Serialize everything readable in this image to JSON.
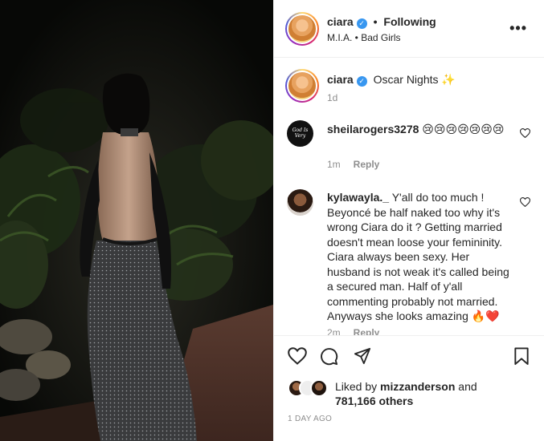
{
  "header": {
    "username": "ciara",
    "separator": "•",
    "follow_status": "Following",
    "audio": "M.I.A. • Bad Girls",
    "more_icon": "•••"
  },
  "caption": {
    "username": "ciara",
    "text": "Oscar Nights",
    "sparkle": "✨",
    "time": "1d"
  },
  "comments": [
    {
      "username": "sheilarogers3278",
      "text": "😢😢😢😢😢😢😢",
      "meta": "1m",
      "reply": "Reply",
      "avatar_text": "God Is Very"
    },
    {
      "username": "kylawayla._",
      "text": "Y'all do too much ! Beyoncé be half naked too why it's wrong Ciara do it ? Getting married doesn't mean loose your femininity. Ciara always been sexy. Her husband is not weak it's called being a secured man. Half of y'all commenting probably not married. Anyways she looks amazing 🔥❤️",
      "meta": "2m",
      "reply": "Reply"
    }
  ],
  "likes": {
    "prefix": "Liked by",
    "user": "mizzanderson",
    "middle": "and",
    "count": "781,166 others"
  },
  "date": "1 DAY AGO",
  "colors": {
    "verified": "#3897f0",
    "text": "#262626",
    "muted": "#8e8e8e",
    "divider": "#efefef"
  },
  "icons": {
    "like": "heart-icon",
    "comment": "comment-icon",
    "share": "share-icon",
    "save": "bookmark-icon"
  }
}
